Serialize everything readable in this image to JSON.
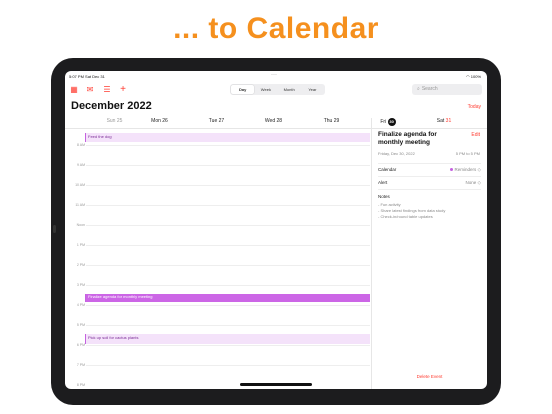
{
  "headline": "... to Calendar",
  "status": {
    "time": "5:07 PM",
    "date": "Sat Dec 31",
    "battery": "100%"
  },
  "toolbar": {
    "view_tabs": [
      {
        "label": "Day",
        "active": true
      },
      {
        "label": "Week",
        "active": false
      },
      {
        "label": "Month",
        "active": false
      },
      {
        "label": "Year",
        "active": false
      }
    ],
    "search_placeholder": "Search"
  },
  "header": {
    "month": "December 2022",
    "today": "Today"
  },
  "days": [
    {
      "label": "Sun 25",
      "muted": true
    },
    {
      "label": "Mon 26",
      "muted": false
    },
    {
      "label": "Tue 27",
      "muted": false
    },
    {
      "label": "Wed 28",
      "muted": false
    },
    {
      "label": "Thu 29",
      "muted": false
    },
    {
      "label": "Fri",
      "num": "30",
      "selected": true
    },
    {
      "label": "Sat",
      "num": "31",
      "muted": false
    }
  ],
  "hours": [
    "8 AM",
    "9 AM",
    "10 AM",
    "11 AM",
    "Noon",
    "1 PM",
    "2 PM",
    "3 PM",
    "4 PM",
    "5 PM",
    "6 PM",
    "7 PM",
    "8 PM",
    "9 PM"
  ],
  "events": [
    {
      "title": "Feed the dog",
      "style": "light"
    },
    {
      "title": "Finalize agenda for monthly meeting",
      "style": "strong"
    },
    {
      "title": "Pick up soil for cactus plants",
      "style": "light"
    }
  ],
  "detail": {
    "title": "Finalize agenda for monthly meeting",
    "edit": "Edit",
    "date": "Friday, Dec 30, 2022",
    "time": "5 PM to 5 PM",
    "calendar_label": "Calendar",
    "calendar_value": "Reminders",
    "alert_label": "Alert",
    "alert_value": "None",
    "notes_label": "Notes",
    "notes": [
      "- Fun activity",
      "- Share latest findings from data study",
      "- Check-in/round table updates"
    ],
    "delete": "Delete Event"
  },
  "colors": {
    "accent": "#ff3b30",
    "headline": "#f5901e",
    "event": "#c561e0"
  }
}
